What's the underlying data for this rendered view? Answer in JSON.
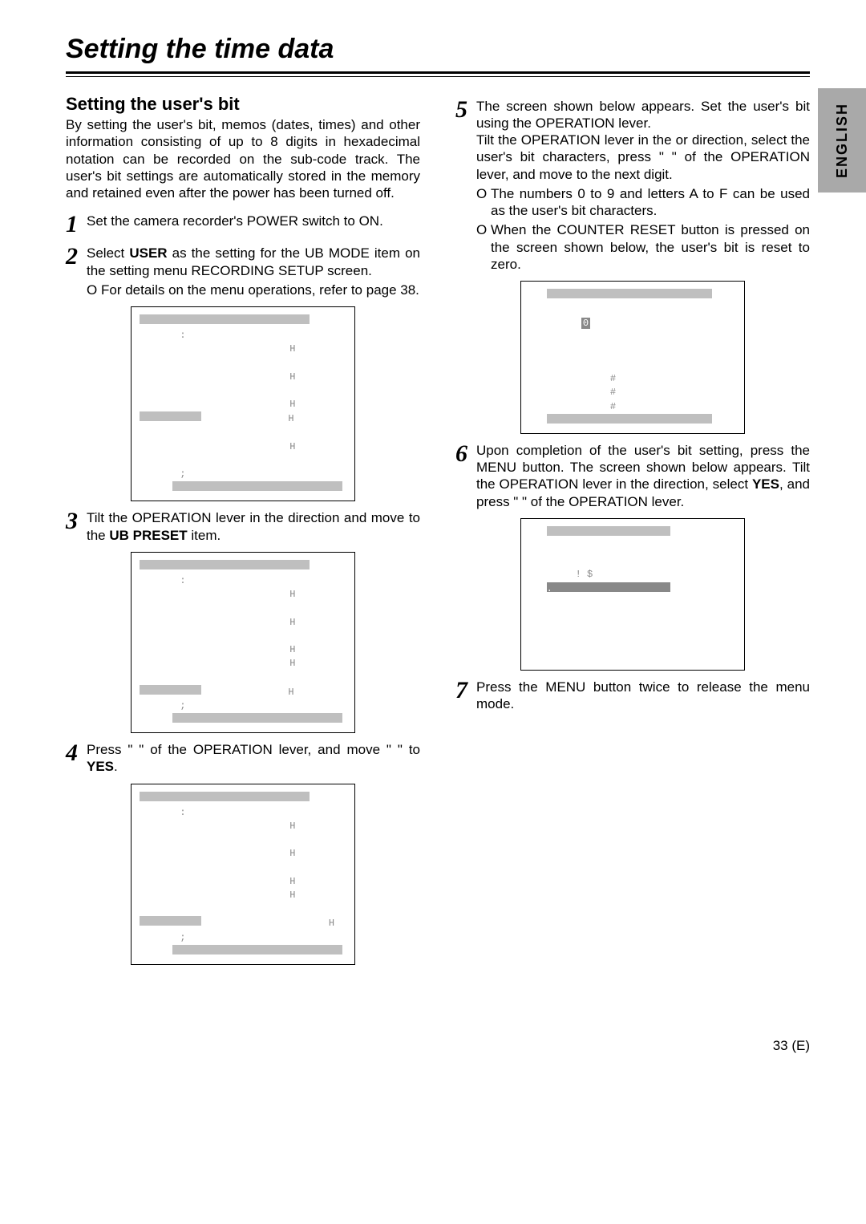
{
  "title": "Setting the time data",
  "lang_tab": "ENGLISH",
  "subhead": "Setting the user's bit",
  "intro": "By setting the user's bit, memos (dates, times) and other information consisting of up to 8 digits in hexadecimal notation can be recorded on the sub-code track.  The user's bit settings are automatically stored in the memory and retained even after the power has been turned off.",
  "steps": {
    "s1": "Set the camera recorder's POWER switch to ON.",
    "s2_a": "Select ",
    "s2_user": "USER",
    "s2_b": " as the setting for the UB MODE item on the setting menu RECORDING SETUP screen.",
    "s2_bullet": "For details on the menu operations, refer to page 38.",
    "s3_a": "Tilt the OPERATION lever in the ",
    "s3_b": " direction and move to the ",
    "s3_ubp": "UB PRESET",
    "s3_c": " item.",
    "s4_a": "Press \"   \" of the OPERATION lever, and move \"   \" to ",
    "s4_yes": "YES",
    "s4_b": ".",
    "s5_a": "The screen shown below appears.  Set the user's bit using the OPERATION lever.",
    "s5_tilt": "Tilt the OPERATION lever in the     or     direction, select the user's bit characters, press \"   \" of the OPERATION lever, and move to the next digit.",
    "s5_b1": "The numbers 0 to 9 and letters A to F can be used as the user's bit characters.",
    "s5_b2": "When the COUNTER RESET button is pressed on the screen shown below, the user's bit is reset to zero.",
    "s6_a": "Upon completion of the user's bit setting, press the MENU button.  The screen shown below appears.  Tilt the OPERATION lever in the      direction, select ",
    "s6_yes": "YES",
    "s6_b": ", and press \"   \" of the OPERATION lever.",
    "s7": "Press the MENU button twice to release the menu mode."
  },
  "panels": {
    "p2": {
      "colon": ":",
      "h1": "H",
      "h2": "H",
      "h3a": "H",
      "h3b": "H",
      "h4": "H",
      "semi": ";"
    },
    "p3": {
      "colon": ":",
      "h1": "H",
      "h2": "H",
      "h3a": "H",
      "h3b": "H",
      "h4": "H",
      "semi": ";"
    },
    "p4": {
      "colon": ":",
      "h1": "H",
      "h2": "H",
      "h3a": "H",
      "h3b": "H",
      "h4": "H",
      "semi": ";"
    },
    "p5": {
      "zero": "0",
      "hh1": "#",
      "hh2": "#",
      "hh3": "#"
    },
    "p6": {
      "bang": "! $",
      "dot": "."
    }
  },
  "page_no": "33 (E)"
}
